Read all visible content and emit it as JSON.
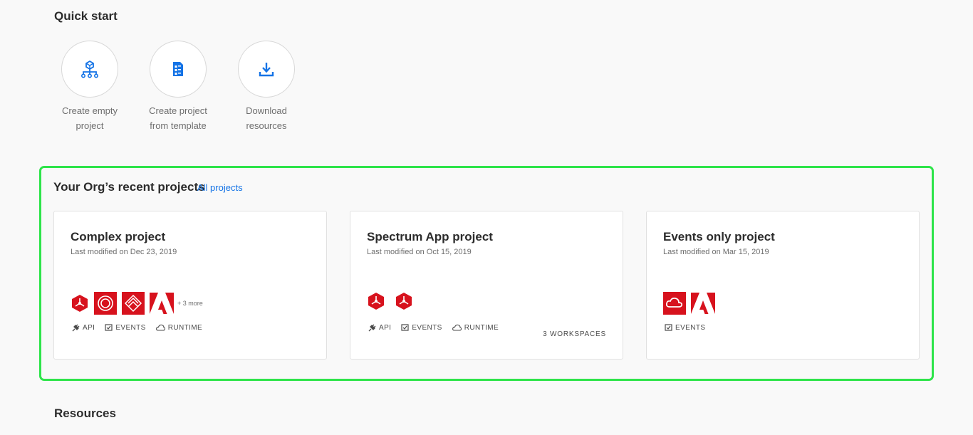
{
  "quick_start": {
    "title": "Quick start",
    "items": [
      {
        "icon": "org-chart-icon",
        "label_line1": "Create empty",
        "label_line2": "project"
      },
      {
        "icon": "template-icon",
        "label_line1": "Create project",
        "label_line2": "from template"
      },
      {
        "icon": "download-icon",
        "label_line1": "Download",
        "label_line2": "resources"
      }
    ]
  },
  "recent": {
    "title": "Your Org’s recent projects",
    "all_link": "All projects",
    "highlight_color": "#2ee44a",
    "cards": [
      {
        "title": "Complex project",
        "date": "Last modified on Dec 23, 2019",
        "icons": [
          "adobe-io-icon",
          "creative-cloud-icon",
          "experience-cloud-icon",
          "adobe-logo-icon"
        ],
        "more": "+ 3 more",
        "tags": [
          "API",
          "EVENTS",
          "RUNTIME"
        ]
      },
      {
        "title": "Spectrum App project",
        "date": "Last modified on Oct 15, 2019",
        "icons": [
          "adobe-io-icon",
          "adobe-io-icon"
        ],
        "tags": [
          "API",
          "EVENTS",
          "RUNTIME"
        ],
        "workspaces": "3 WORKSPACES"
      },
      {
        "title": "Events only project",
        "date": "Last modified on Mar 15, 2019",
        "icons": [
          "creative-cloud-icon",
          "adobe-logo-icon"
        ],
        "tags": [
          "EVENTS"
        ]
      }
    ]
  },
  "resources": {
    "title": "Resources"
  },
  "colors": {
    "accent": "#1473e6",
    "brand_red": "#d7121d"
  }
}
